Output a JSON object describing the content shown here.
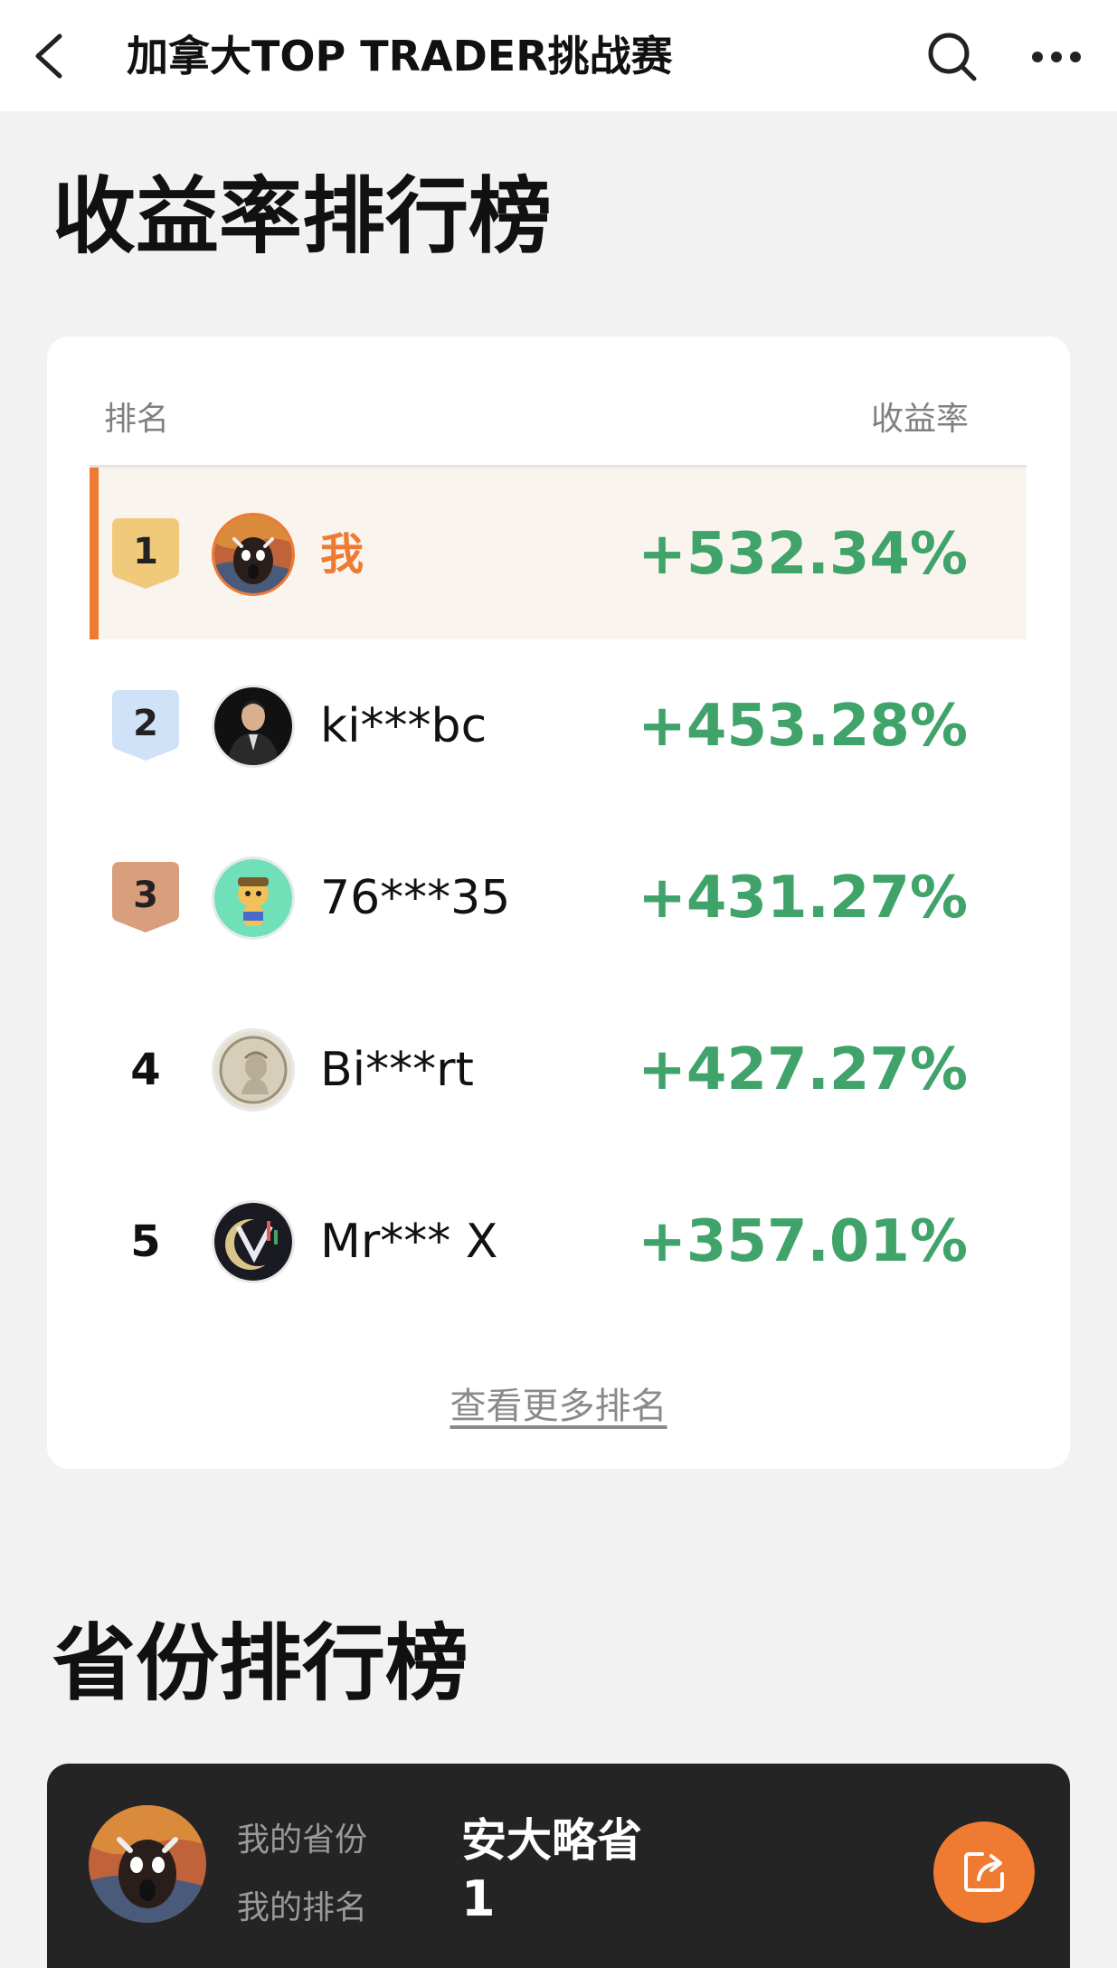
{
  "header": {
    "title": "加拿大TOP TRADER挑战赛",
    "back_icon": "chevron-left-icon",
    "search_icon": "search-icon",
    "more_icon": "more-horizontal-icon"
  },
  "return_ranking": {
    "title": "收益率排行榜",
    "col_rank": "排名",
    "col_return": "收益率",
    "rows": [
      {
        "rank": "1",
        "name": "我",
        "return": "+532.34%",
        "is_me": true,
        "badge": "gold"
      },
      {
        "rank": "2",
        "name": "ki***bc",
        "return": "+453.28%",
        "is_me": false,
        "badge": "silver"
      },
      {
        "rank": "3",
        "name": "76***35",
        "return": "+431.27%",
        "is_me": false,
        "badge": "bronze"
      },
      {
        "rank": "4",
        "name": "Bi***rt",
        "return": "+427.27%",
        "is_me": false,
        "badge": "none"
      },
      {
        "rank": "5",
        "name": "Mr*** X",
        "return": "+357.01%",
        "is_me": false,
        "badge": "none"
      }
    ],
    "more_link": "查看更多排名"
  },
  "province_ranking": {
    "title": "省份排行榜",
    "my_province_label": "我的省份",
    "my_province_value": "安大略省",
    "my_rank_label": "我的排名",
    "my_rank_value": "1",
    "share_icon": "share-icon"
  },
  "colors": {
    "accent": "#ef7a32",
    "positive": "#3fa36a",
    "gold": "#f0c97a",
    "silver": "#cfe2f8",
    "bronze": "#d99e7c"
  }
}
